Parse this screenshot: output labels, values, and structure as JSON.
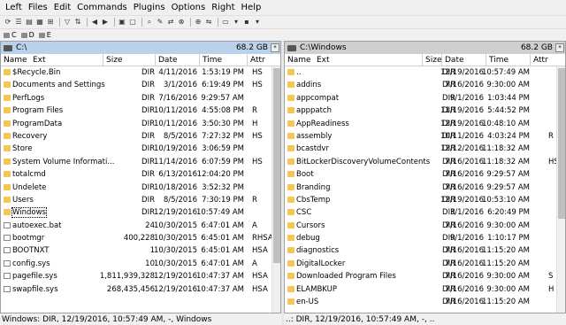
{
  "menu": [
    "Left",
    "Files",
    "Edit",
    "Commands",
    "Plugins",
    "Options",
    "Right",
    "Help"
  ],
  "drives": [
    "C",
    "D",
    "E"
  ],
  "left": {
    "path": "C:\\",
    "free": "68.2 GB",
    "columns": {
      "name": "Name",
      "ext": "Ext",
      "size": "Size",
      "date": "Date",
      "time": "Time",
      "attr": "Attr"
    },
    "rows": [
      {
        "name": "$Recycle.Bin",
        "size": "DIR",
        "date": "4/11/2016",
        "time": "1:53:19 PM",
        "attr": "HS",
        "type": "folder"
      },
      {
        "name": "Documents and Settings",
        "size": "DIR",
        "date": "3/1/2016",
        "time": "6:19:49 PM",
        "attr": "HS",
        "type": "folder"
      },
      {
        "name": "PerfLogs",
        "size": "DIR",
        "date": "7/16/2016",
        "time": "9:29:57 AM",
        "attr": "",
        "type": "folder"
      },
      {
        "name": "Program Files",
        "size": "DIR",
        "date": "10/11/2016",
        "time": "4:55:08 PM",
        "attr": "R",
        "type": "folder"
      },
      {
        "name": "ProgramData",
        "size": "DIR",
        "date": "10/11/2016",
        "time": "3:50:30 PM",
        "attr": "H",
        "type": "folder"
      },
      {
        "name": "Recovery",
        "size": "DIR",
        "date": "8/5/2016",
        "time": "7:27:32 PM",
        "attr": "HS",
        "type": "folder"
      },
      {
        "name": "Store",
        "size": "DIR",
        "date": "10/19/2016",
        "time": "3:06:59 PM",
        "attr": "",
        "type": "folder"
      },
      {
        "name": "System Volume Informati...",
        "size": "DIR",
        "date": "11/14/2016",
        "time": "6:07:59 PM",
        "attr": "HS",
        "type": "folder"
      },
      {
        "name": "totalcmd",
        "size": "DIR",
        "date": "6/13/2016",
        "time": "12:04:20 PM",
        "attr": "",
        "type": "folder"
      },
      {
        "name": "Undelete",
        "size": "DIR",
        "date": "10/18/2016",
        "time": "3:52:32 PM",
        "attr": "",
        "type": "folder"
      },
      {
        "name": "Users",
        "size": "DIR",
        "date": "8/5/2016",
        "time": "7:30:19 PM",
        "attr": "R",
        "type": "folder"
      },
      {
        "name": "Windows",
        "size": "DIR",
        "date": "12/19/2016",
        "time": "10:57:49 AM",
        "attr": "",
        "type": "folder",
        "cursor": true
      },
      {
        "name": "autoexec.bat",
        "size": "24",
        "date": "10/30/2015",
        "time": "6:47:01 AM",
        "attr": "A",
        "type": "file"
      },
      {
        "name": "bootmgr",
        "size": "400,228",
        "date": "10/30/2015",
        "time": "6:45:01 AM",
        "attr": "RHSA",
        "type": "file"
      },
      {
        "name": "BOOTNXT",
        "size": "1",
        "date": "10/30/2015",
        "time": "6:45:01 AM",
        "attr": "HSA",
        "type": "file"
      },
      {
        "name": "config.sys",
        "size": "10",
        "date": "10/30/2015",
        "time": "6:47:01 AM",
        "attr": "A",
        "type": "file"
      },
      {
        "name": "pagefile.sys",
        "size": "1,811,939,328",
        "date": "12/19/2016",
        "time": "10:47:37 AM",
        "attr": "HSA",
        "type": "file"
      },
      {
        "name": "swapfile.sys",
        "size": "268,435,456",
        "date": "12/19/2016",
        "time": "10:47:37 AM",
        "attr": "HSA",
        "type": "file"
      }
    ],
    "status": "Windows: DIR, 12/19/2016, 10:57:49 AM, -, Windows"
  },
  "right": {
    "path": "C:\\Windows",
    "free": "68.2 GB",
    "columns": {
      "name": "Name",
      "ext": "Ext",
      "size": "Size",
      "date": "Date",
      "time": "Time",
      "attr": "Attr"
    },
    "rows": [
      {
        "name": "..",
        "size": "DIR",
        "date": "12/19/2016",
        "time": "10:57:49 AM",
        "attr": "",
        "type": "folder"
      },
      {
        "name": "addins",
        "size": "DIR",
        "date": "7/16/2016",
        "time": "9:30:00 AM",
        "attr": "",
        "type": "folder"
      },
      {
        "name": "appcompat",
        "size": "DIR",
        "date": "9/1/2016",
        "time": "1:03:44 PM",
        "attr": "",
        "type": "folder"
      },
      {
        "name": "apppatch",
        "size": "DIR",
        "date": "11/19/2016",
        "time": "5:44:52 PM",
        "attr": "",
        "type": "folder"
      },
      {
        "name": "AppReadiness",
        "size": "DIR",
        "date": "12/19/2016",
        "time": "10:48:10 AM",
        "attr": "",
        "type": "folder"
      },
      {
        "name": "assembly",
        "size": "DIR",
        "date": "10/11/2016",
        "time": "4:03:24 PM",
        "attr": "R",
        "type": "folder"
      },
      {
        "name": "bcastdvr",
        "size": "DIR",
        "date": "12/12/2016",
        "time": "11:18:32 AM",
        "attr": "",
        "type": "folder"
      },
      {
        "name": "BitLockerDiscoveryVolumeContents",
        "size": "DIR",
        "date": "7/16/2016",
        "time": "11:18:32 AM",
        "attr": "HS",
        "type": "folder"
      },
      {
        "name": "Boot",
        "size": "DIR",
        "date": "7/16/2016",
        "time": "9:29:57 AM",
        "attr": "",
        "type": "folder"
      },
      {
        "name": "Branding",
        "size": "DIR",
        "date": "7/16/2016",
        "time": "9:29:57 AM",
        "attr": "",
        "type": "folder"
      },
      {
        "name": "CbsTemp",
        "size": "DIR",
        "date": "12/19/2016",
        "time": "10:53:10 AM",
        "attr": "",
        "type": "folder"
      },
      {
        "name": "CSC",
        "size": "DIR",
        "date": "3/1/2016",
        "time": "6:20:49 PM",
        "attr": "",
        "type": "folder"
      },
      {
        "name": "Cursors",
        "size": "DIR",
        "date": "7/16/2016",
        "time": "9:30:00 AM",
        "attr": "",
        "type": "folder"
      },
      {
        "name": "debug",
        "size": "DIR",
        "date": "9/1/2016",
        "time": "1:10:17 PM",
        "attr": "",
        "type": "folder"
      },
      {
        "name": "diagnostics",
        "size": "DIR",
        "date": "7/16/2016",
        "time": "11:15:20 AM",
        "attr": "",
        "type": "folder"
      },
      {
        "name": "DigitalLocker",
        "size": "DIR",
        "date": "7/16/2016",
        "time": "11:15:20 AM",
        "attr": "",
        "type": "folder"
      },
      {
        "name": "Downloaded Program Files",
        "size": "DIR",
        "date": "7/16/2016",
        "time": "9:30:00 AM",
        "attr": "S",
        "type": "folder"
      },
      {
        "name": "ELAMBKUP",
        "size": "DIR",
        "date": "7/16/2016",
        "time": "9:30:00 AM",
        "attr": "H",
        "type": "folder"
      },
      {
        "name": "en-US",
        "size": "DIR",
        "date": "7/16/2016",
        "time": "11:15:20 AM",
        "attr": "",
        "type": "folder"
      }
    ],
    "status": "..: DIR, 12/19/2016, 10:57:49 AM, -, .."
  }
}
